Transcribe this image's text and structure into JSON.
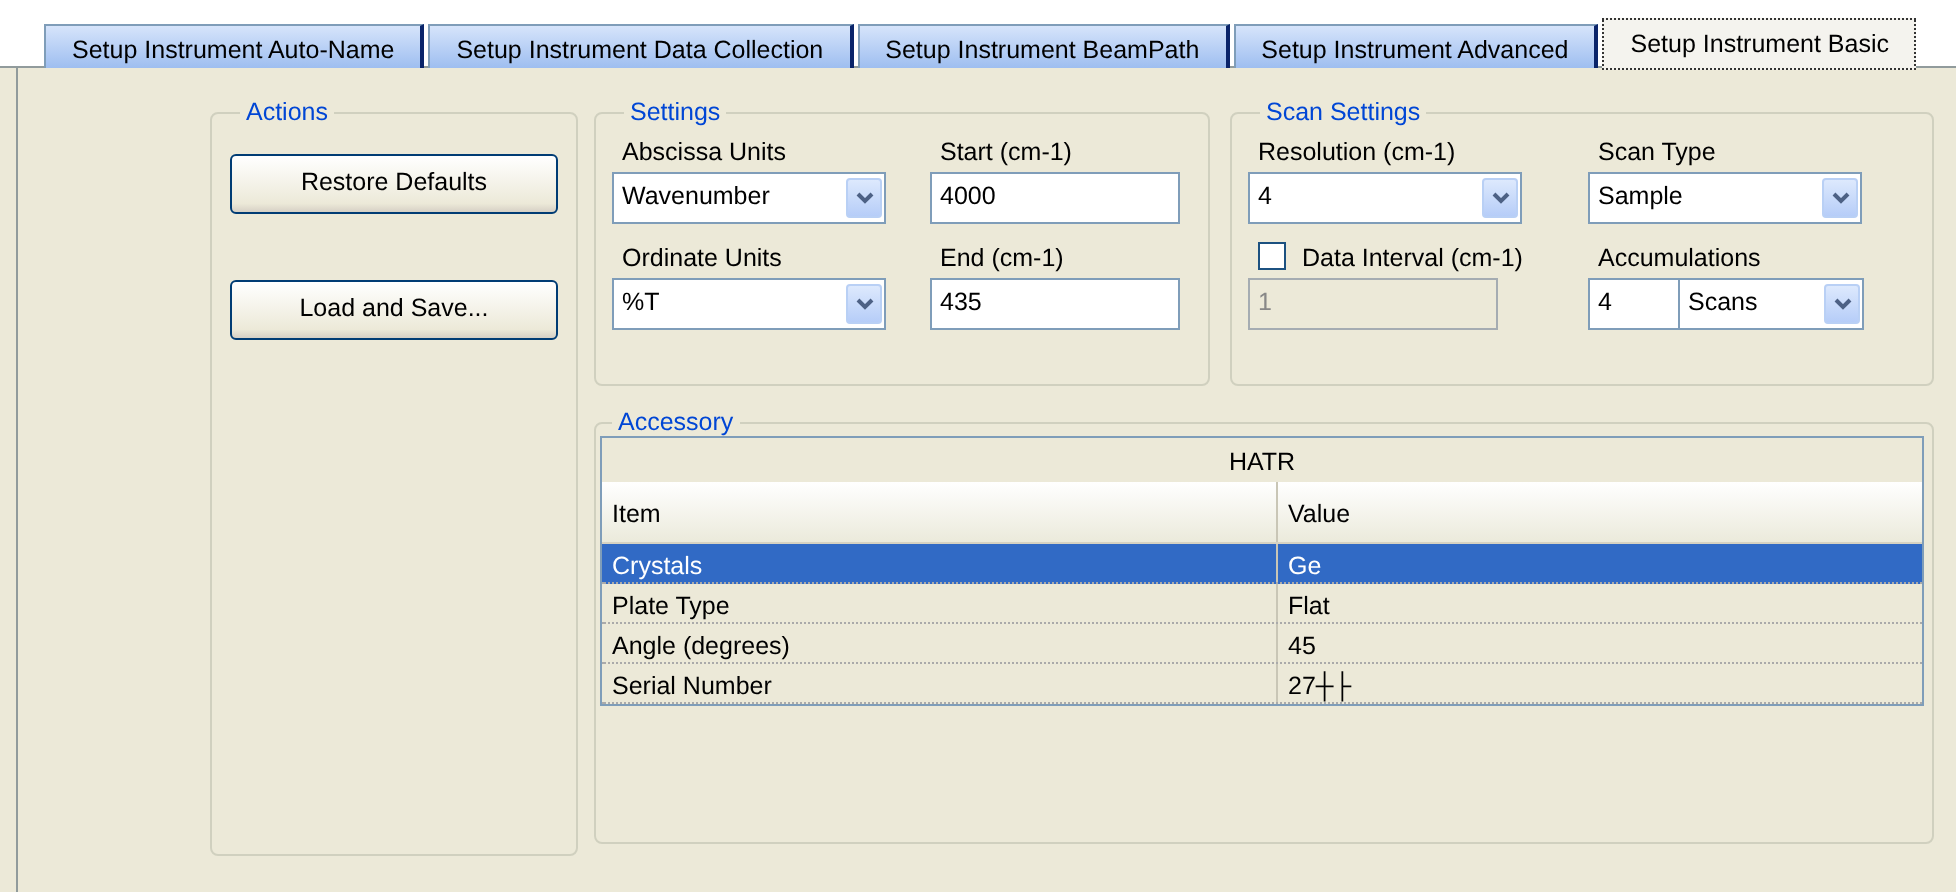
{
  "tabs": [
    {
      "label": "Setup Instrument Auto-Name",
      "selected": false
    },
    {
      "label": "Setup Instrument Data Collection",
      "selected": false
    },
    {
      "label": "Setup Instrument BeamPath",
      "selected": false
    },
    {
      "label": "Setup Instrument Advanced",
      "selected": false
    },
    {
      "label": "Setup Instrument Basic",
      "selected": true
    }
  ],
  "actions": {
    "title": "Actions",
    "buttons": [
      "Restore Defaults",
      "Load and Save..."
    ]
  },
  "settings": {
    "title": "Settings",
    "fields": [
      {
        "kind": "select",
        "label": "Abscissa Units",
        "value": "Wavenumber"
      },
      {
        "kind": "text",
        "label": "Start (cm-1)",
        "value": "4000"
      },
      {
        "kind": "select",
        "label": "Ordinate Units",
        "value": "%T"
      },
      {
        "kind": "text",
        "label": "End (cm-1)",
        "value": "435"
      }
    ]
  },
  "scan_settings": {
    "title": "Scan Settings",
    "fields": [
      {
        "kind": "select",
        "label": "Resolution (cm-1)",
        "value": "4"
      },
      {
        "kind": "select",
        "label": "Scan Type",
        "value": "Sample"
      },
      {
        "kind": "checkbox",
        "label": "Data Interval (cm-1)",
        "checked": false,
        "value": "1",
        "disabled": true
      },
      {
        "kind": "combo",
        "label": "Accumulations",
        "value": "4",
        "unit": "Scans"
      }
    ]
  },
  "accessory": {
    "title": "Accessory",
    "table": {
      "caption": "HATR",
      "columns": [
        "Item",
        "Value"
      ],
      "rows": [
        {
          "cells": [
            "Crystals",
            "Ge"
          ],
          "selected": true
        },
        {
          "cells": [
            "Plate Type",
            "Flat"
          ],
          "selected": false
        },
        {
          "cells": [
            "Angle (degrees)",
            "45"
          ],
          "selected": false
        },
        {
          "cells": [
            "Serial Number",
            "27┼├"
          ],
          "selected": false
        }
      ]
    }
  }
}
